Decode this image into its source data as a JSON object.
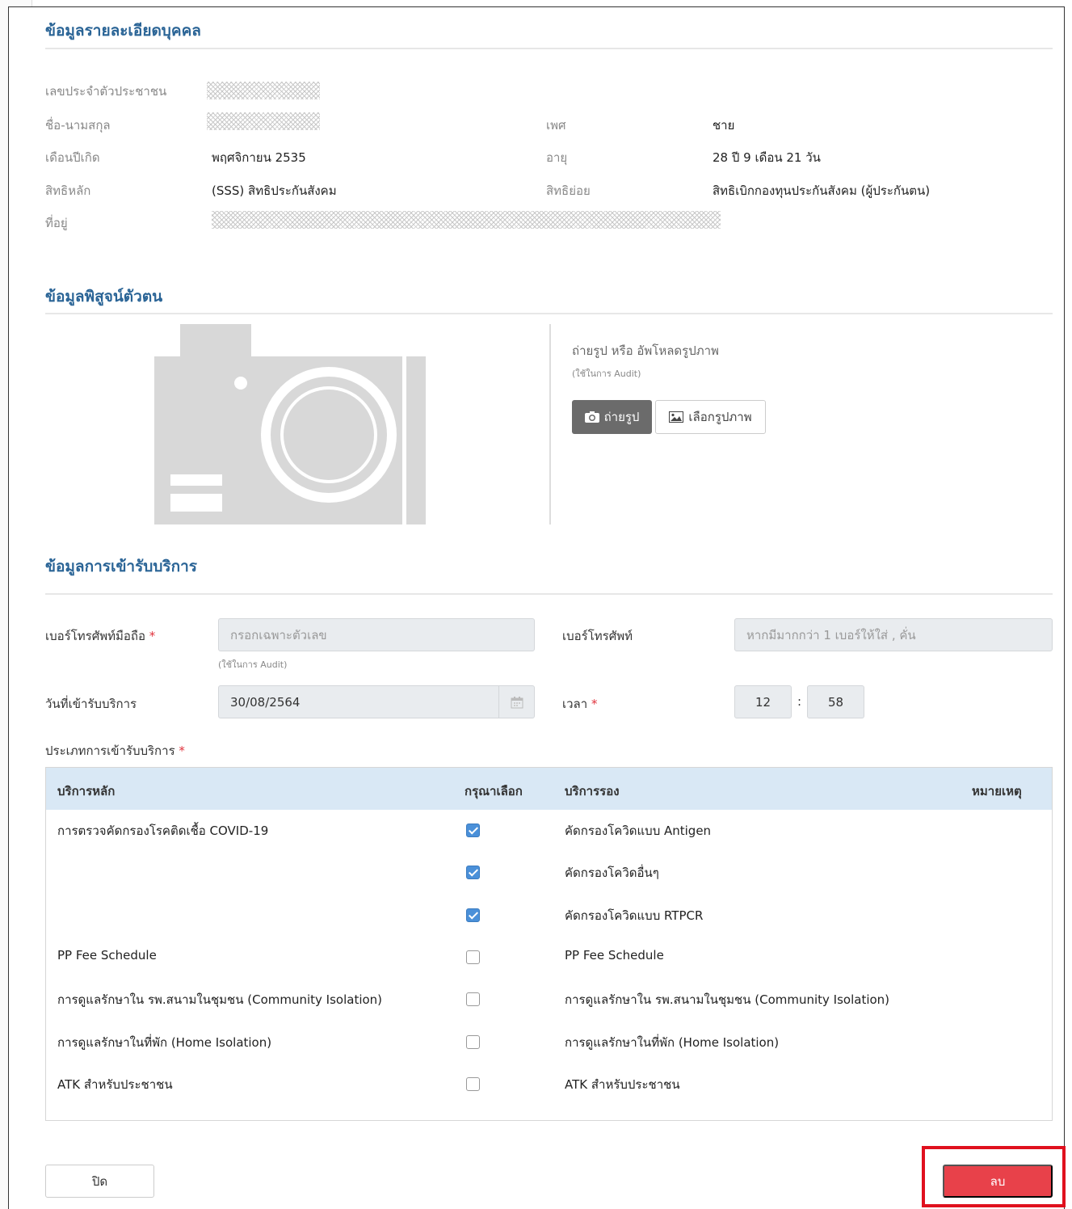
{
  "sections": {
    "personal": "ข้อมูลรายละเอียดบุคคล",
    "identity": "ข้อมูลพิสูจน์ตัวตน",
    "service": "ข้อมูลการเข้ารับบริการ"
  },
  "personal": {
    "id_label": "เลขประจำตัวประชาชน",
    "name_label": "ชื่อ-นามสกุล",
    "gender_label": "เพศ",
    "gender_value": "ชาย",
    "birth_label": "เดือนปีเกิด",
    "birth_value": "พฤศจิกายน 2535",
    "age_label": "อายุ",
    "age_value": "28 ปี 9 เดือน 21 วัน",
    "main_right_label": "สิทธิหลัก",
    "main_right_value": "(SSS) สิทธิประกันสังคม",
    "sub_right_label": "สิทธิย่อย",
    "sub_right_value": "สิทธิเบิกกองทุนประกันสังคม (ผู้ประกันตน)",
    "address_label": "ที่อยู่"
  },
  "identity": {
    "upload_title": "ถ่ายรูป หรือ อัพโหลดรูปภาพ",
    "upload_sub": "(ใช้ในการ Audit)",
    "take_photo": "ถ่ายรูป",
    "choose_image": "เลือกรูปภาพ"
  },
  "service": {
    "mobile_label": "เบอร์โทรศัพท์มือถือ",
    "mobile_placeholder": "กรอกเฉพาะตัวเลข",
    "mobile_hint": "(ใช้ในการ Audit)",
    "phone_label": "เบอร์โทรศัพท์",
    "phone_placeholder": "หากมีมากกว่า 1 เบอร์ให้ใส่ , คั่น",
    "date_label": "วันที่เข้ารับบริการ",
    "date_value": "30/08/2564",
    "time_label": "เวลา",
    "hour": "12",
    "minute": "58",
    "type_label": "ประเภทการเข้ารับบริการ",
    "required_mark": "*"
  },
  "table": {
    "headers": [
      "บริการหลัก",
      "กรุณาเลือก",
      "บริการรอง",
      "หมายเหตุ"
    ],
    "rows": [
      {
        "main": "การตรวจคัดกรองโรคติดเชื้อ COVID-19",
        "checked": true,
        "sub": "คัดกรองโควิดแบบ Antigen"
      },
      {
        "main": "",
        "checked": true,
        "sub": "คัดกรองโควิดอื่นๆ"
      },
      {
        "main": "",
        "checked": true,
        "sub": "คัดกรองโควิดแบบ RTPCR"
      },
      {
        "main": "PP Fee Schedule",
        "checked": false,
        "sub": "PP Fee Schedule"
      },
      {
        "main": "การดูแลรักษาใน รพ.สนามในชุมชน (Community Isolation)",
        "checked": false,
        "sub": "การดูแลรักษาใน รพ.สนามในชุมชน (Community Isolation)"
      },
      {
        "main": "การดูแลรักษาในที่พัก (Home Isolation)",
        "checked": false,
        "sub": "การดูแลรักษาในที่พัก (Home Isolation)"
      },
      {
        "main": "ATK สำหรับประชาชน",
        "checked": false,
        "sub": "ATK สำหรับประชาชน"
      }
    ]
  },
  "footer": {
    "close": "ปิด",
    "delete": "ลบ"
  },
  "icons": [
    "camera-placeholder-icon",
    "camera-icon",
    "image-icon",
    "calendar-icon"
  ],
  "colors": {
    "title": "#2a6496",
    "delete": "#e8414a",
    "highlight": "#e0101e",
    "table_header": "#d9e8f5"
  }
}
